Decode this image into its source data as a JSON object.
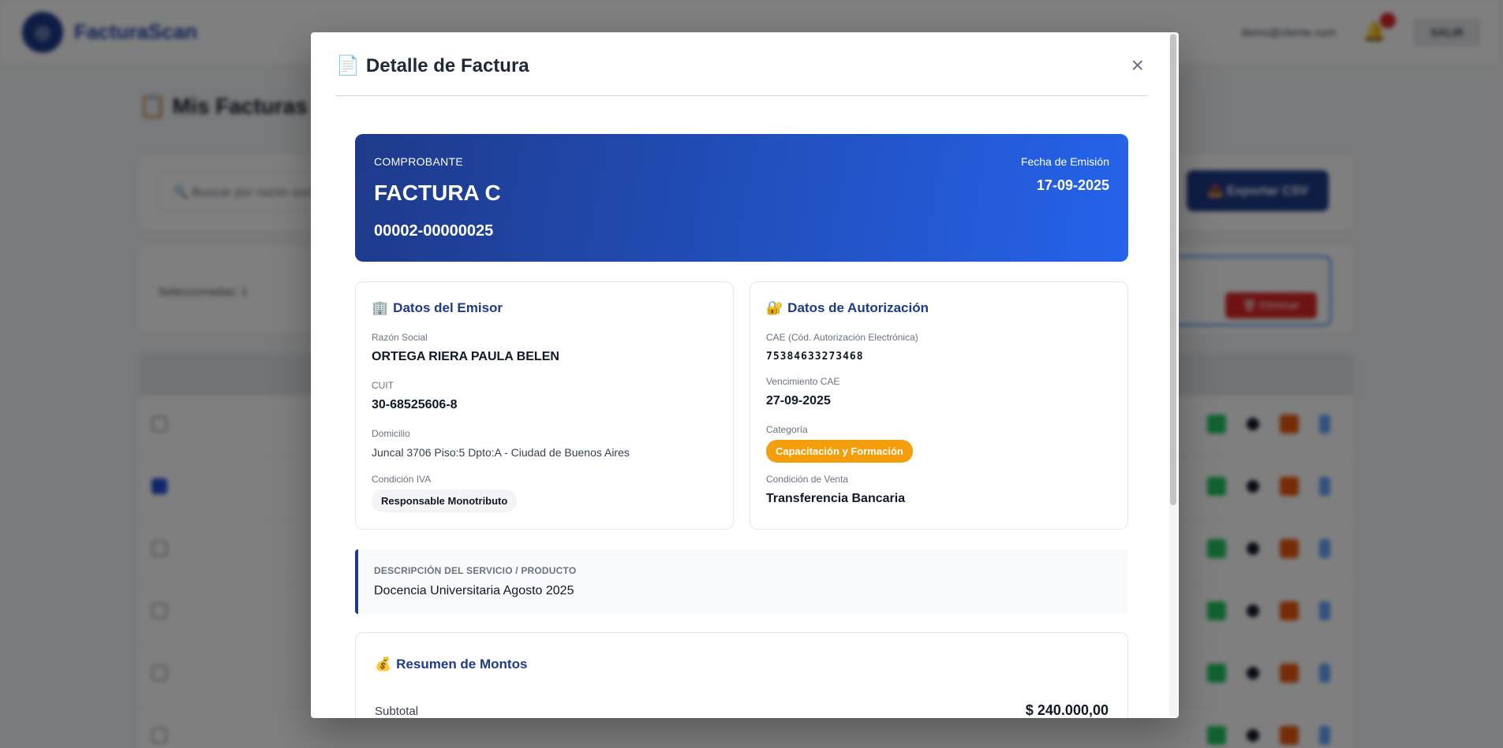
{
  "app": {
    "brand": "FacturaScan",
    "user_email": "demo@cliente.com",
    "logout_label": "SALIR",
    "page_title": "📋 Mis Facturas",
    "search_placeholder": "🔍 Buscar por razón social",
    "export_label": "📥 Exportar CSV",
    "selected_text": "Seleccionadas: 1",
    "delete_label": "🗑 Eliminar"
  },
  "modal": {
    "title": "Detalle de Factura",
    "title_icon": "📄",
    "close_label": "×",
    "comprobante": {
      "label": "COMPROBANTE",
      "type": "FACTURA C",
      "number": "00002-00000025",
      "date_label": "Fecha de Emisión",
      "date": "17-09-2025"
    },
    "emisor": {
      "icon": "🏢",
      "title": "Datos del Emisor",
      "razon_label": "Razón Social",
      "razon": "ORTEGA RIERA PAULA BELEN",
      "cuit_label": "CUIT",
      "cuit": "30-68525606-8",
      "domicilio_label": "Domicilio",
      "domicilio": "Juncal 3706 Piso:5 Dpto:A - Ciudad de Buenos Aires",
      "iva_label": "Condición IVA",
      "iva": "Responsable Monotributo"
    },
    "autorizacion": {
      "icon": "🔐",
      "title": "Datos de Autorización",
      "cae_label": "CAE (Cód. Autorización Electrónica)",
      "cae": "75384633273468",
      "venc_label": "Vencimiento CAE",
      "venc": "27-09-2025",
      "categoria_label": "Categoría",
      "categoria": "Capacitación y Formación",
      "venta_label": "Condición de Venta",
      "venta": "Transferencia Bancaria"
    },
    "descripcion": {
      "label": "DESCRIPCIÓN DEL SERVICIO / PRODUCTO",
      "text": "Docencia Universitaria Agosto 2025"
    },
    "montos": {
      "icon": "💰",
      "title": "Resumen de Montos",
      "subtotal_label": "Subtotal",
      "subtotal": "$ 240.000,00"
    }
  },
  "colors": {
    "primary": "#1e3a8a",
    "accent": "#2563eb",
    "badge_orange": "#f59e0b"
  }
}
